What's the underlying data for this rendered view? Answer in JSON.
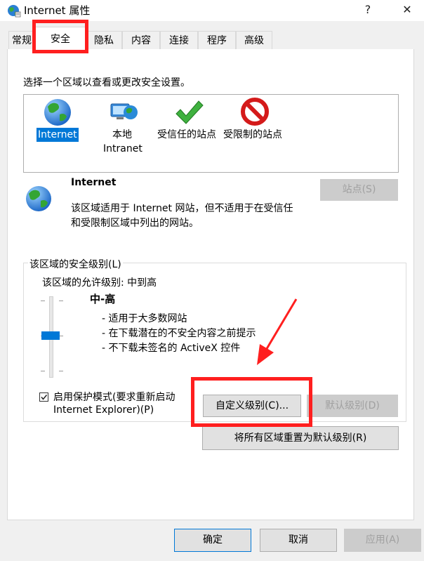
{
  "window": {
    "title": "Internet 属性",
    "help": "?",
    "close": "✕"
  },
  "tabs": [
    "常规",
    "安全",
    "隐私",
    "内容",
    "连接",
    "程序",
    "高级"
  ],
  "active_tab": "安全",
  "instruction": "选择一个区域以查看或更改安全设置。",
  "zones": [
    {
      "label": "Internet",
      "label2": "",
      "icon": "globe-icon",
      "selected": true
    },
    {
      "label": "本地",
      "label2": "Intranet",
      "icon": "local-intranet-icon",
      "selected": false
    },
    {
      "label": "受信任的站点",
      "label2": "",
      "icon": "trusted-check-icon",
      "selected": false
    },
    {
      "label": "受限制的站点",
      "label2": "",
      "icon": "restricted-icon",
      "selected": false
    }
  ],
  "zone_info": {
    "name": "Internet",
    "desc1": "该区域适用于 Internet 网站，但不适用于在受信任",
    "desc2": "和受限制区域中列出的网站。",
    "sites_button": "站点(S)"
  },
  "security_level": {
    "group_title": "该区域的安全级别(L)",
    "allowed": "该区域的允许级别: 中到高",
    "level_name": "中-高",
    "bullets": [
      "- 适用于大多数网站",
      "- 在下载潜在的不安全内容之前提示",
      "- 不下载未签名的 ActiveX 控件"
    ],
    "slider_level_fraction": 0.5
  },
  "protected_mode": {
    "checked": true,
    "line1": "启用保护模式(要求重新启动",
    "line2": "Internet Explorer)(P)"
  },
  "buttons": {
    "custom_level": "自定义级别(C)...",
    "default_level": "默认级别(D)",
    "reset_all": "将所有区域重置为默认级别(R)",
    "ok": "确定",
    "cancel": "取消",
    "apply": "应用(A)"
  },
  "colors": {
    "annotation_red": "#ff1f1f",
    "selection_blue": "#0078d7",
    "slider_thumb": "#0078d7"
  }
}
